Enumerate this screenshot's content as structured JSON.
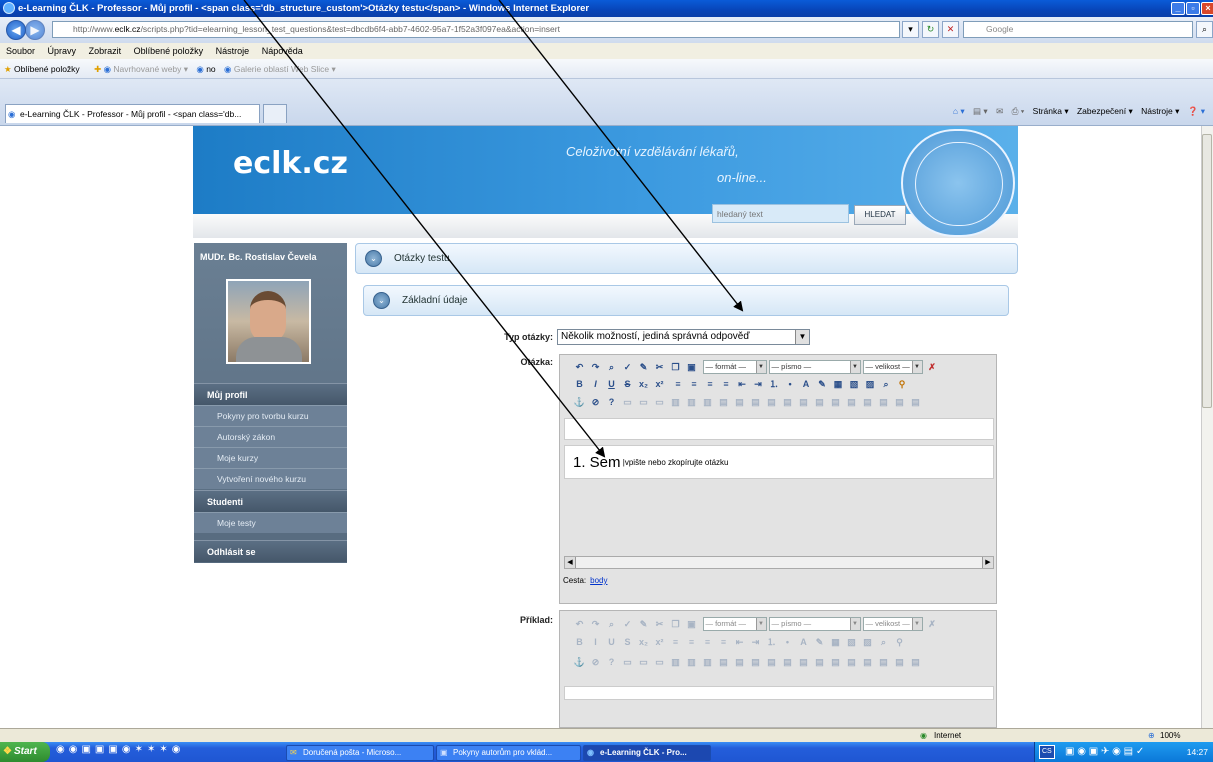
{
  "window": {
    "title": "e-Learning ČLK - Professor - Můj profil - <span class='db_structure_custom'>Otázky testu</span> - Windows Internet Explorer",
    "url_prefix": "http://www.",
    "url_domain": "eclk.cz",
    "url_rest": "/scripts.php?tid=elearning_lesson_test_questions&test=dbcdb6f4-abb7-4602-95a7-1f52a3f097ea&action=insert",
    "search_placeholder": "Google"
  },
  "menu": [
    "Soubor",
    "Úpravy",
    "Zobrazit",
    "Oblíbené položky",
    "Nástroje",
    "Nápověda"
  ],
  "favorites": {
    "label": "Oblíbené položky",
    "suggested": "Navrhované weby ▾",
    "item1": "no",
    "item2": "Galerie oblastí Web Slice ▾"
  },
  "tab": {
    "label": "e-Learning ČLK - Professor - Můj profil - <span class='db..."
  },
  "command_bar": {
    "page": "Stránka ▾",
    "security": "Zabezpečení ▾",
    "tools": "Nástroje ▾"
  },
  "site": {
    "logo": "eclk.cz",
    "slogan_line1": "Celoživotní vzdělávání lékařů,",
    "slogan_line2": "on-line...",
    "search_placeholder": "hledaný text",
    "search_button": "HLEDAT"
  },
  "sidebar": {
    "user_name": "MUDr. Bc. Rostislav Čevela",
    "sections": [
      {
        "head": "Můj profil",
        "items": [
          "Pokyny pro tvorbu kurzu",
          "Autorský zákon",
          "Moje kurzy",
          "Vytvoření nového kurzu"
        ]
      },
      {
        "head": "Studenti",
        "items": [
          "Moje testy"
        ]
      },
      {
        "head": "Odhlásit se",
        "items": []
      }
    ]
  },
  "main": {
    "panel1": "Otázky testu",
    "panel2": "Základní údaje",
    "type_label": "Typ otázky:",
    "type_value": "Několik možností, jediná správná odpověď",
    "question_label": "Otázka:",
    "example_label": "Příklad:",
    "editor": {
      "format": "— formát —",
      "font": "— písmo —",
      "size": "— velikost —",
      "content_number": "1. Sem",
      "content_rest": "|vpište nebo zkopírujte otázku",
      "path_label": "Cesta:",
      "path_value": "body"
    }
  },
  "statusbar": {
    "zone": "Internet",
    "zoom": "100%"
  },
  "taskbar": {
    "start": "Start",
    "tasks": [
      "Doručená pošta - Microso...",
      "Pokyny autorům pro vklád...",
      "e-Learning ČLK - Pro..."
    ],
    "lang": "CS",
    "clock": "14:27"
  }
}
